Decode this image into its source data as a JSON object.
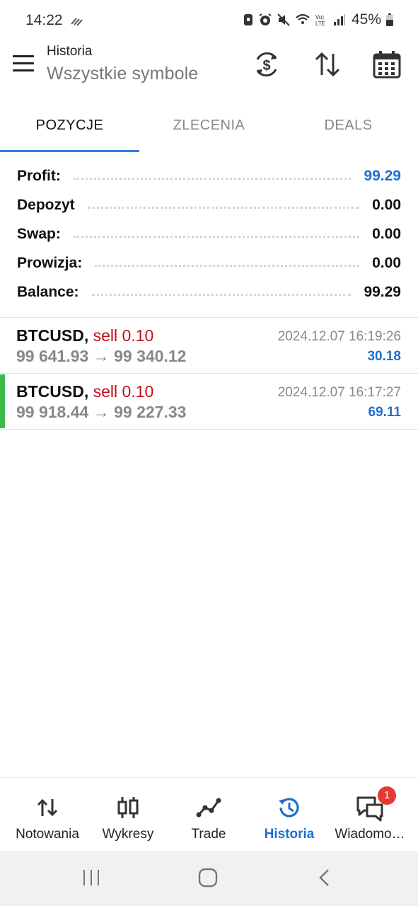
{
  "status_bar": {
    "time": "14:22",
    "battery": "45%"
  },
  "header": {
    "title": "Historia",
    "subtitle": "Wszystkie symbole"
  },
  "tabs": [
    {
      "label": "POZYCJE",
      "active": true
    },
    {
      "label": "ZLECENIA",
      "active": false
    },
    {
      "label": "DEALS",
      "active": false
    }
  ],
  "summary": [
    {
      "label": "Profit:",
      "value": "99.29"
    },
    {
      "label": "Depozyt",
      "value": "0.00"
    },
    {
      "label": "Swap:",
      "value": "0.00"
    },
    {
      "label": "Prowizja:",
      "value": "0.00"
    },
    {
      "label": "Balance:",
      "value": "99.29"
    }
  ],
  "positions": [
    {
      "symbol": "BTCUSD,",
      "direction": "sell 0.10",
      "prices": "99 641.93 → 99 340.12",
      "time": "2024.12.07 16:19:26",
      "profit": "30.18"
    },
    {
      "symbol": "BTCUSD,",
      "direction": "sell 0.10",
      "prices": "99 918.44 → 99 227.33",
      "time": "2024.12.07 16:17:27",
      "profit": "69.11"
    }
  ],
  "bottom_nav": [
    {
      "label": "Notowania",
      "icon": "quotes-arrows-icon"
    },
    {
      "label": "Wykresy",
      "icon": "candlestick-chart-icon"
    },
    {
      "label": "Trade",
      "icon": "trade-line-icon"
    },
    {
      "label": "Historia",
      "icon": "history-clock-icon",
      "active": true
    },
    {
      "label": "Wiadomo…",
      "icon": "chat-messages-icon",
      "badge": "1"
    }
  ],
  "colors": {
    "accent": "#1f6fd0",
    "sell": "#c0101a",
    "profit_bar": "#3cba4a",
    "badge": "#e53935"
  }
}
